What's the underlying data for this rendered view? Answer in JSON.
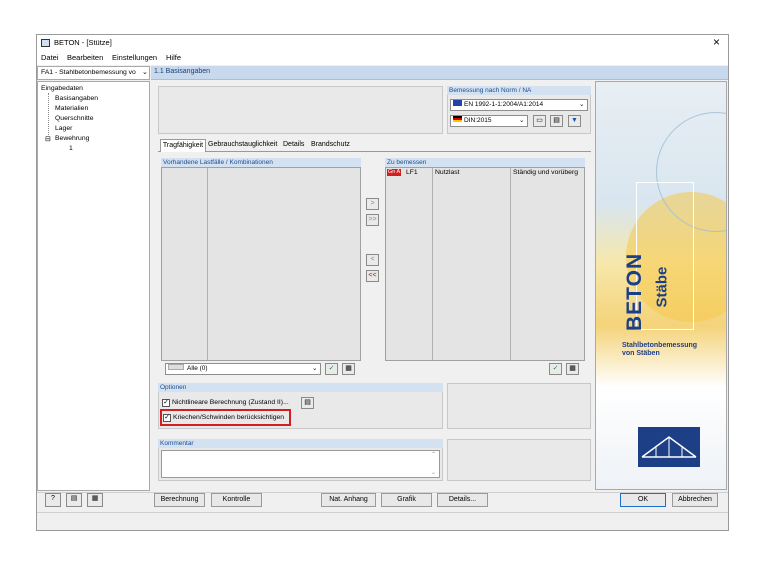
{
  "window": {
    "title": "BETON - [Stütze]",
    "close_glyph": "×"
  },
  "menu": [
    "Datei",
    "Bearbeiten",
    "Einstellungen",
    "Hilfe"
  ],
  "case_select": "FA1 - Stahlbetonbemessung vo",
  "tree": {
    "root": "Eingabedaten",
    "items": [
      "Basisangaben",
      "Materialien",
      "Querschnitte",
      "Lager"
    ],
    "group": "Bewehrung",
    "subitem": "1"
  },
  "panel_title": "1.1 Basisangaben",
  "norm": {
    "label": "Bemessung nach Norm / NA",
    "standard": "EN 1992-1-1:2004/A1:2014",
    "annex": "DIN:2015"
  },
  "tabs": [
    "Tragfähigkeit",
    "Gebrauchstauglichkeit",
    "Details",
    "Brandschutz"
  ],
  "available": {
    "title": "Vorhandene Lastfälle / Kombinationen",
    "filter": "Alle (0)"
  },
  "to_design": {
    "title": "Zu bemessen",
    "rows": [
      {
        "badge": "Gn A",
        "id": "LF1",
        "name": "Nutzlast",
        "type": "Ständig und vorüberg"
      }
    ]
  },
  "move_buttons": [
    ">",
    ">>",
    "<",
    "<<"
  ],
  "options": {
    "title": "Optionen",
    "nonlinear": "Nichtlineare Berechnung (Zustand II)...",
    "creep": "Kriechen/Schwinden berücksichtigen"
  },
  "comment": {
    "title": "Kommentar",
    "value": ""
  },
  "brand": {
    "title": "BETON",
    "subtitle": "Stäbe",
    "desc_line1": "Stahlbetonbemessung",
    "desc_line2": "von Stäben"
  },
  "footer_buttons": [
    "Berechnung",
    "Kontrolle",
    "Nat. Anhang",
    "Grafik",
    "Details...",
    "OK",
    "Abbrechen"
  ],
  "colors": {
    "accent_red": "#d11f1f",
    "header_blue": "#c8d9ee",
    "title_blue": "#1a4f91"
  }
}
